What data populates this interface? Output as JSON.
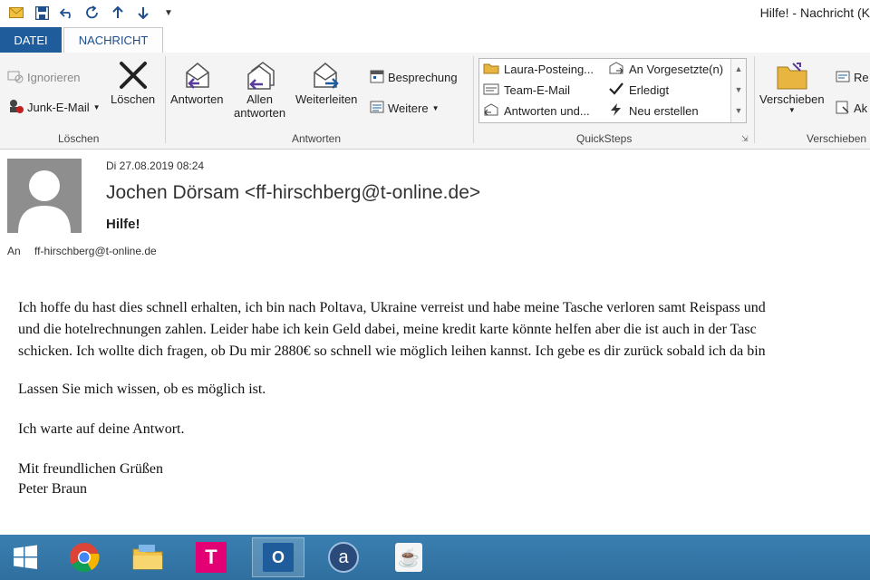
{
  "window": {
    "title": "Hilfe! - Nachricht (HTML)",
    "visible_title": "Hilfe! - Nachricht (K"
  },
  "quick_access": [
    "mail-icon",
    "save-icon",
    "undo-icon",
    "redo-icon",
    "up-arrow-icon",
    "down-arrow-icon",
    "customize-icon"
  ],
  "tabs": [
    {
      "label": "DATEI"
    },
    {
      "label": "NACHRICHT"
    }
  ],
  "ribbon": {
    "delete_group": {
      "label": "Löschen",
      "ignore": "Ignorieren",
      "junk": "Junk-E-Mail",
      "delete": "Löschen"
    },
    "respond_group": {
      "label": "Antworten",
      "reply": "Antworten",
      "reply_all_1": "Allen",
      "reply_all_2": "antworten",
      "forward": "Weiterleiten",
      "meeting": "Besprechung",
      "more": "Weitere"
    },
    "quicksteps_group": {
      "label": "QuickSteps",
      "items": [
        "Laura-Posteing...",
        "An Vorgesetzte(n)",
        "Team-E-Mail",
        "Erledigt",
        "Antworten und...",
        "Neu erstellen"
      ]
    },
    "move_group": {
      "label": "Verschieben",
      "move": "Verschieben",
      "rules": "Re",
      "actions": "Ak"
    }
  },
  "message": {
    "date": "Di 27.08.2019 08:24",
    "from": "Jochen Dörsam <ff-hirschberg@t-online.de>",
    "subject": "Hilfe!",
    "to_label": "An",
    "to": "ff-hirschberg@t-online.de",
    "body": [
      "Ich hoffe du hast dies schnell erhalten, ich bin nach Poltava, Ukraine verreist und habe meine Tasche verloren samt Reispass und",
      "und die hotelrechnungen zahlen. Leider habe ich kein Geld dabei, meine kredit karte könnte helfen aber die ist auch in der Tasc",
      "schicken. Ich wollte dich fragen, ob Du mir 2880€ so schnell wie möglich leihen kannst. Ich gebe es dir zurück sobald ich da bin",
      "Lassen Sie mich wissen, ob es möglich ist.",
      "Ich warte auf deine Antwort.",
      "Mit freundlichen Grüßen",
      "Peter Braun"
    ]
  },
  "taskbar": {
    "items": [
      "start-button",
      "chrome-icon",
      "file-explorer-icon",
      "telekom-icon",
      "outlook-icon",
      "a-app-icon",
      "java-icon"
    ],
    "telekom_glyph": "T",
    "outlook_glyph": "O",
    "a_glyph": "a",
    "java_glyph": "☕"
  },
  "colors": {
    "accent": "#1e5c9c",
    "taskbar": "#3276a7"
  }
}
